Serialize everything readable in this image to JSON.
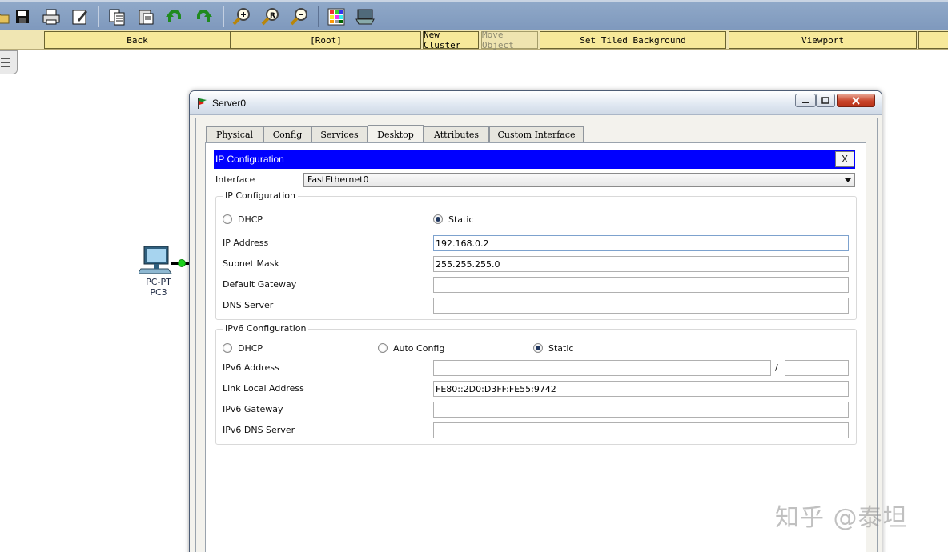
{
  "toolbar": {
    "icons": [
      "open-icon",
      "save-icon",
      "print-icon",
      "edit-icon",
      "copy-icon",
      "paste-icon",
      "undo-icon",
      "redo-icon",
      "zoom-in-icon",
      "zoom-reset-icon",
      "zoom-out-icon",
      "palette-icon",
      "device-dialog-icon"
    ]
  },
  "navbar": {
    "back": "Back",
    "root": "[Root]",
    "new_cluster": "New Cluster",
    "move_object": "Move Object",
    "set_tiled_background": "Set Tiled Background",
    "viewport": "Viewport"
  },
  "canvas": {
    "pc_type": "PC-PT",
    "pc_name": "PC3",
    "link_status_color": "#1cd11c"
  },
  "window": {
    "title": "Server0",
    "tabs": [
      "Physical",
      "Config",
      "Services",
      "Desktop",
      "Attributes",
      "Custom Interface"
    ],
    "active_tab": "Desktop"
  },
  "app": {
    "header": "IP Configuration",
    "close_label": "X",
    "header_color": "#0000ff",
    "interface_label": "Interface",
    "interface_value": "FastEthernet0",
    "ipv4": {
      "group_title": "IP Configuration",
      "dhcp_label": "DHCP",
      "static_label": "Static",
      "mode": "Static",
      "ip_label": "IP Address",
      "ip_value": "192.168.0.2",
      "mask_label": "Subnet Mask",
      "mask_value": "255.255.255.0",
      "gateway_label": "Default Gateway",
      "gateway_value": "",
      "dns_label": "DNS Server",
      "dns_value": ""
    },
    "ipv6": {
      "group_title": "IPv6 Configuration",
      "dhcp_label": "DHCP",
      "auto_label": "Auto Config",
      "static_label": "Static",
      "mode": "Static",
      "address_label": "IPv6 Address",
      "address_value": "",
      "prefix_separator": "/",
      "prefix_value": "",
      "link_local_label": "Link Local Address",
      "link_local_value": "FE80::2D0:D3FF:FE55:9742",
      "gateway_label": "IPv6 Gateway",
      "gateway_value": "",
      "dns_label": "IPv6 DNS Server",
      "dns_value": ""
    }
  },
  "watermark": "知乎 @泰坦"
}
